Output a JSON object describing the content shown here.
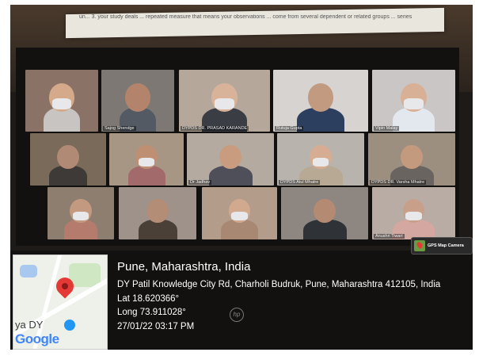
{
  "slide": {
    "text": "un... 3. your study deals ... repeated measure that means your observations ... come from several dependent or related groups ... series"
  },
  "participants": [
    {
      "name": "",
      "face": "#d4aa8a",
      "bg": "#8a7366",
      "body": "#c8c4c2"
    },
    {
      "name": "Sajog Shendge",
      "face": "#b3846b",
      "bg": "#7d7874",
      "body": "#535a63"
    },
    {
      "name": "DYPDS DR. PRASAD KARANDE",
      "face": "#d8b39a",
      "bg": "#b5a89a",
      "body": "#3b3d45"
    },
    {
      "name": "Rutuja Gupta",
      "face": "#c29a80",
      "bg": "#d6d3d1",
      "body": "#2d3f5e"
    },
    {
      "name": "Vipin Malay",
      "face": "#d7b095",
      "bg": "#c9c6c5",
      "body": "#e3e7ee"
    },
    {
      "name": "",
      "face": "#b08a74",
      "bg": "#7a6a5a",
      "body": "#3e3a38"
    },
    {
      "name": "",
      "face": "#bf8f73",
      "bg": "#a79684",
      "body": "#a36a6b"
    },
    {
      "name": "Dr Jadhav",
      "face": "#c99c80",
      "bg": "#b5aa9f",
      "body": "#4e4f58"
    },
    {
      "name": "DYPDS Atul Mhatre",
      "face": "#d6ad93",
      "bg": "#b8b3ad",
      "body": "#b8a995"
    },
    {
      "name": "DYPDS DR. Varsha Mhatre",
      "face": "#c49a7e",
      "bg": "#9c8f80",
      "body": "#6a6460"
    },
    {
      "name": "",
      "face": "#c39a80",
      "bg": "#8d7e70",
      "body": "#b57b6d"
    },
    {
      "name": "",
      "face": "#b48d76",
      "bg": "#9e928a",
      "body": "#4b4038"
    },
    {
      "name": "",
      "face": "#d1a98f",
      "bg": "#b39d8a",
      "body": "#a88773"
    },
    {
      "name": "",
      "face": "#b48b72",
      "bg": "#8e8781",
      "body": "#2f3338"
    },
    {
      "name": "Anushri Tiwari",
      "face": "#c8a08a",
      "bg": "#b9aca4",
      "body": "#d4a7a0"
    }
  ],
  "gps": {
    "badge_label": "GPS Map Camera",
    "place": "Pune, Maharashtra, India",
    "address": "DY Patil Knowledge City Rd, Charholi Budruk, Pune, Maharashtra 412105, India",
    "lat": "Lat 18.620366°",
    "long": "Long 73.911028°",
    "datetime": "27/01/22 03:17 PM",
    "map_label": "ya DY",
    "map_brand": "Google"
  },
  "colors": {
    "overlay_bg": "#12100f",
    "pin": "#e53935",
    "text": "#ffffff"
  }
}
